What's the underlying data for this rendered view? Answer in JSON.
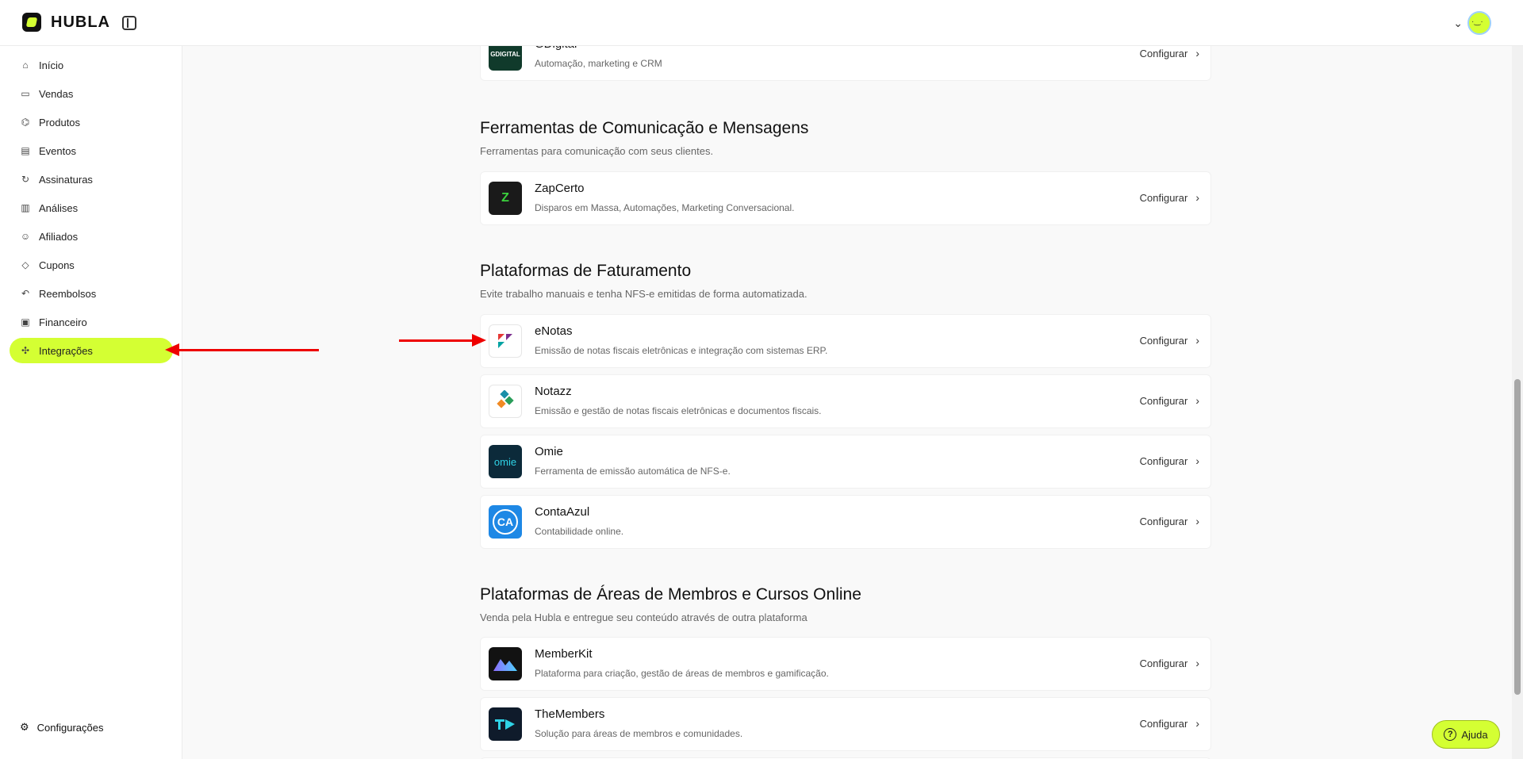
{
  "brand": {
    "name": "HUBLA"
  },
  "sidebar": {
    "items": [
      {
        "label": "Início",
        "icon": "home-icon"
      },
      {
        "label": "Vendas",
        "icon": "cash-icon"
      },
      {
        "label": "Produtos",
        "icon": "boxes-icon"
      },
      {
        "label": "Eventos",
        "icon": "ticket-icon"
      },
      {
        "label": "Assinaturas",
        "icon": "refresh-icon"
      },
      {
        "label": "Análises",
        "icon": "bar-chart-icon"
      },
      {
        "label": "Afiliados",
        "icon": "users-icon"
      },
      {
        "label": "Cupons",
        "icon": "tag-icon"
      },
      {
        "label": "Reembolsos",
        "icon": "undo-icon"
      },
      {
        "label": "Financeiro",
        "icon": "wallet-icon"
      },
      {
        "label": "Integrações",
        "icon": "puzzle-icon",
        "active": true
      }
    ],
    "settings_label": "Configurações"
  },
  "sections": {
    "top_card": {
      "name": "GDigital",
      "desc": "Automação, marketing e CRM",
      "logo_text": "GDIGITAL"
    },
    "comunicacao": {
      "title": "Ferramentas de Comunicação e Mensagens",
      "subtitle": "Ferramentas para comunicação com seus clientes.",
      "cards": [
        {
          "name": "ZapCerto",
          "desc": "Disparos em Massa, Automações, Marketing Conversacional.",
          "logo_text": "Z"
        }
      ]
    },
    "faturamento": {
      "title": "Plataformas de Faturamento",
      "subtitle": "Evite trabalho manuais e tenha NFS-e emitidas de forma automatizada.",
      "cards": [
        {
          "name": "eNotas",
          "desc": "Emissão de notas fiscais eletrônicas e integração com sistemas ERP."
        },
        {
          "name": "Notazz",
          "desc": "Emissão e gestão de notas fiscais eletrônicas e documentos fiscais."
        },
        {
          "name": "Omie",
          "desc": "Ferramenta de emissão automática de NFS-e.",
          "logo_text": "omie"
        },
        {
          "name": "ContaAzul",
          "desc": "Contabilidade online.",
          "logo_text": "CA"
        }
      ]
    },
    "membros": {
      "title": "Plataformas de Áreas de Membros e Cursos Online",
      "subtitle": "Venda pela Hubla e entregue seu conteúdo através de outra plataforma",
      "cards": [
        {
          "name": "MemberKit",
          "desc": "Plataforma para criação, gestão de áreas de membros e gamificação."
        },
        {
          "name": "TheMembers",
          "desc": "Solução para áreas de membros e comunidades."
        }
      ]
    }
  },
  "configure_label": "Configurar",
  "help_label": "Ajuda",
  "colors": {
    "accent": "#d4ff33",
    "arrow": "#e00000"
  }
}
